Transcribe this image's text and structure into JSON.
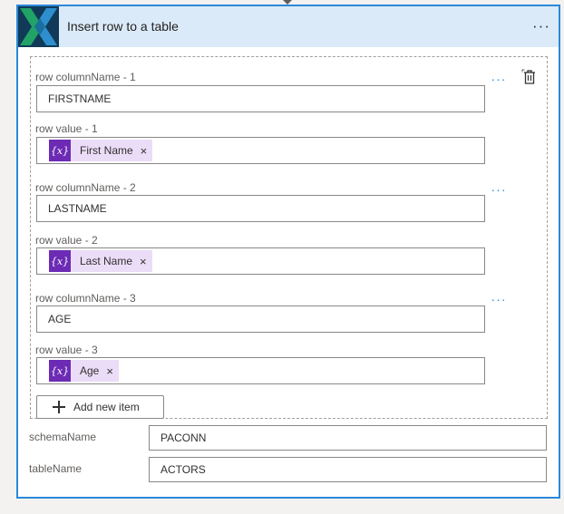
{
  "card": {
    "title": "Insert row to a table",
    "more_label": "···"
  },
  "rows": [
    {
      "column_label": "row columnName - 1",
      "column_value": "FIRSTNAME",
      "value_label": "row value - 1",
      "token": "First Name"
    },
    {
      "column_label": "row columnName - 2",
      "column_value": "LASTNAME",
      "value_label": "row value - 2",
      "token": "Last Name"
    },
    {
      "column_label": "row columnName - 3",
      "column_value": "AGE",
      "value_label": "row value - 3",
      "token": "Age"
    }
  ],
  "token_icon_text": "{x}",
  "token_remove": "×",
  "row_more_label": "···",
  "add_item_label": "Add new item",
  "schema": {
    "label": "schemaName",
    "value": "PACONN"
  },
  "table": {
    "label": "tableName",
    "value": "ACTORS"
  },
  "icons": {
    "logo": "excel-x-logo-icon",
    "trash": "delete-icon",
    "add": "plus-icon"
  },
  "colors": {
    "accent": "#2b88d8",
    "header_bg": "#dbeaf8",
    "token_bg": "#ebdcf7",
    "token_icon_bg": "#6c2ab5"
  }
}
